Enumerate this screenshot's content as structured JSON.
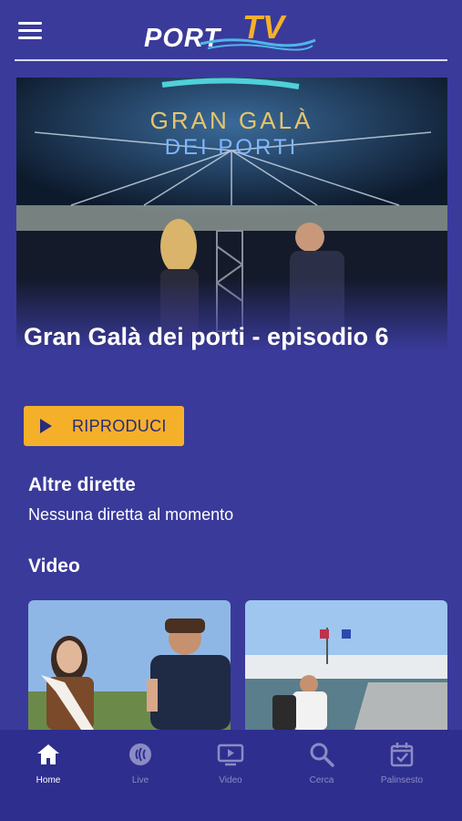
{
  "header": {
    "menu_icon": "hamburger-menu-icon",
    "logo": {
      "part1": "PORT",
      "part2": "TV",
      "colors": {
        "port": "#ffffff",
        "tv": "#f5b02a"
      }
    }
  },
  "hero": {
    "image_text": {
      "line1": "GRAN GALÀ",
      "line2": "DEI PORTI"
    },
    "title": "Gran Galà dei porti - episodio 6",
    "play_button": {
      "label": "RIPRODUCI",
      "icon": "play-icon"
    }
  },
  "live_section": {
    "title": "Altre dirette",
    "empty_text": "Nessuna diretta al momento"
  },
  "video_section": {
    "title": "Video"
  },
  "tabbar": {
    "items": [
      {
        "label": "Home",
        "icon": "home-icon",
        "active": true
      },
      {
        "label": "Live",
        "icon": "live-signal-icon",
        "active": false
      },
      {
        "label": "Video",
        "icon": "tv-play-icon",
        "active": false
      },
      {
        "label": "Cerca",
        "icon": "search-icon",
        "active": false
      },
      {
        "label": "Palinsesto",
        "icon": "calendar-check-icon",
        "active": false
      }
    ]
  },
  "colors": {
    "background": "#3a3a9b",
    "tabbar": "#2e2e8f",
    "accent": "#f5b02a",
    "inactive_tab": "#8b8bc4"
  }
}
